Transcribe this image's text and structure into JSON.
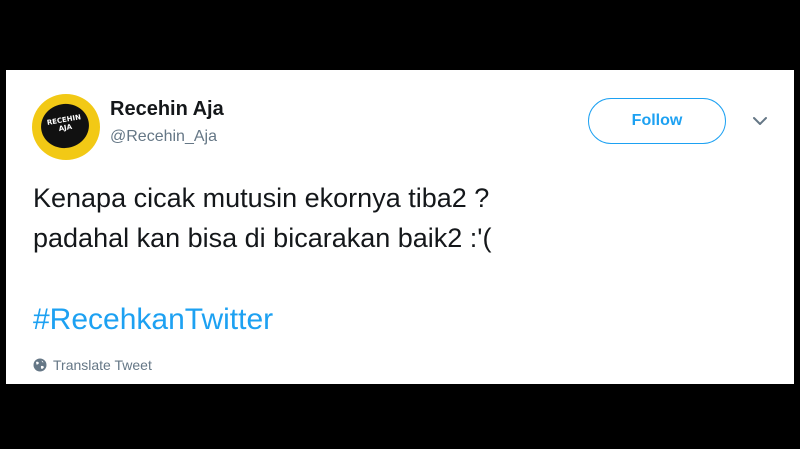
{
  "tweet": {
    "author_name": "Recehin Aja",
    "handle": "@Recehin_Aja",
    "avatar_text": [
      "RECEHIN",
      "AJA"
    ],
    "follow_label": "Follow",
    "text_lines": [
      "Kenapa cicak mutusin ekornya tiba2 ?",
      "padahal kan bisa di bicarakan baik2 :'("
    ],
    "hashtag": "#RecehkanTwitter",
    "translate_label": "Translate Tweet"
  },
  "icons": {
    "caret": "chevron-down-icon",
    "translate": "globe-icon"
  },
  "colors": {
    "accent": "#1da1f2",
    "text": "#14171a",
    "muted": "#657786",
    "avatar_ring": "#f2c915",
    "background": "#000000"
  }
}
